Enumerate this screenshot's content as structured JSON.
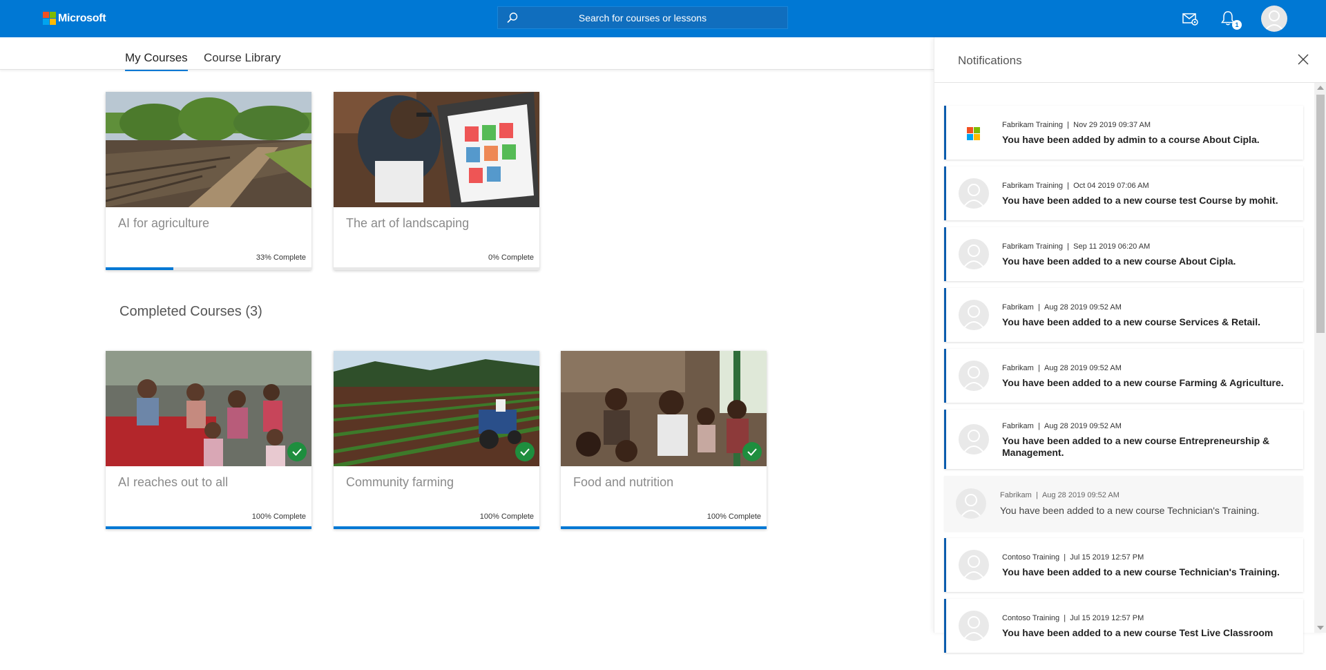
{
  "header": {
    "brand": "Microsoft",
    "brand_colors": [
      "#f25022",
      "#7fba00",
      "#00a4ef",
      "#ffb900"
    ],
    "search_placeholder": "Search for courses or lessons",
    "notification_count": "1",
    "accent": "#0078d4"
  },
  "tabs": [
    {
      "label": "My Courses",
      "active": true
    },
    {
      "label": "Course Library",
      "active": false
    }
  ],
  "in_progress_courses": [
    {
      "title": "AI for agriculture",
      "progress_label": "33% Complete",
      "progress": 0.33,
      "image": "farm-field"
    },
    {
      "title": "The art of landscaping",
      "progress_label": "0% Complete",
      "progress": 0.0,
      "image": "tablet-design"
    }
  ],
  "completed_section": {
    "title": "Completed Courses",
    "count": "(3)"
  },
  "completed_courses": [
    {
      "title": "AI reaches out to all",
      "progress_label": "100% Complete",
      "progress": 1.0,
      "image": "children-group"
    },
    {
      "title": "Community farming",
      "progress_label": "100% Complete",
      "progress": 1.0,
      "image": "tractor-field"
    },
    {
      "title": "Food and nutrition",
      "progress_label": "100% Complete",
      "progress": 1.0,
      "image": "mothers-children"
    }
  ],
  "notifications_panel": {
    "title": "Notifications",
    "items": [
      {
        "source": "Fabrikam Training",
        "time": "Nov 29 2019 09:37 AM",
        "message": "You have been added by admin to a course About Cipla.",
        "avatar": "ms-logo",
        "unread": true
      },
      {
        "source": "Fabrikam Training",
        "time": "Oct 04 2019 07:06 AM",
        "message": "You have been added to a new course test Course by mohit.",
        "avatar": "person",
        "unread": true
      },
      {
        "source": "Fabrikam Training",
        "time": "Sep 11 2019 06:20 AM",
        "message": "You have been added to a new course About Cipla.",
        "avatar": "person",
        "unread": true
      },
      {
        "source": "Fabrikam",
        "time": "Aug 28 2019 09:52 AM",
        "message": "You have been added to a new course Services & Retail.",
        "avatar": "person",
        "unread": true
      },
      {
        "source": "Fabrikam",
        "time": "Aug 28 2019 09:52 AM",
        "message": "You have been added to a new course Farming & Agriculture.",
        "avatar": "person",
        "unread": true
      },
      {
        "source": "Fabrikam",
        "time": "Aug 28 2019 09:52 AM",
        "message": "You have been added to a new course Entrepreneurship & Management.",
        "avatar": "person",
        "unread": true
      },
      {
        "source": "Fabrikam",
        "time": "Aug 28 2019 09:52 AM",
        "message": "You have been added to a new course Technician's Training.",
        "avatar": "person",
        "unread": false
      },
      {
        "source": "Contoso Training",
        "time": "Jul 15 2019 12:57 PM",
        "message": "You have been added to a new course Technician's Training.",
        "avatar": "person",
        "unread": true
      },
      {
        "source": "Contoso Training",
        "time": "Jul 15 2019 12:57 PM",
        "message": "You have been added to a new course Test Live Classroom",
        "avatar": "person",
        "unread": true
      }
    ]
  }
}
